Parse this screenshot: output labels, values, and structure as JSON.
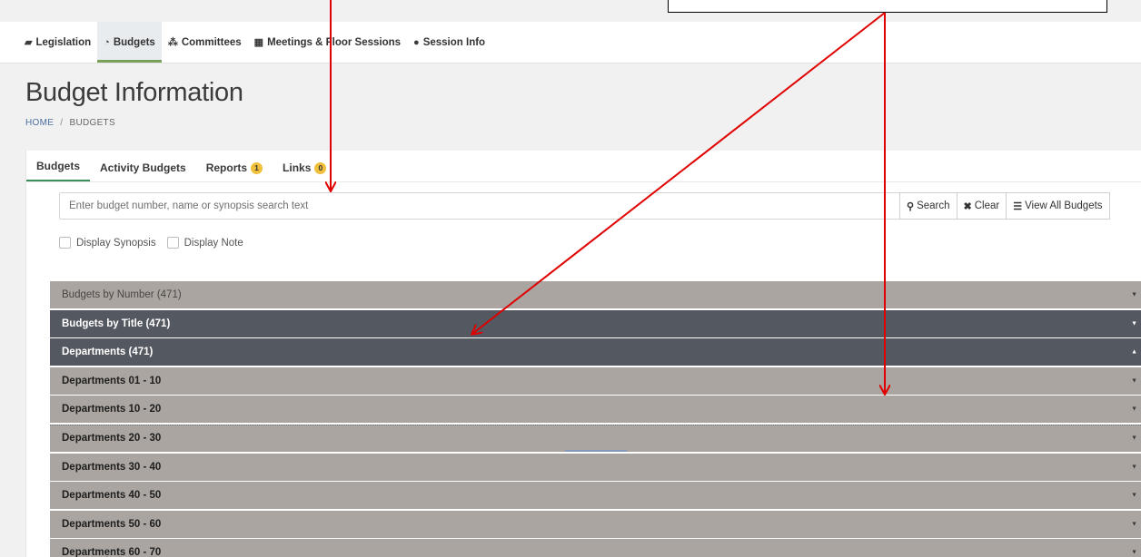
{
  "topnav": {
    "items": [
      {
        "label": "Legislation",
        "icon": "book-icon",
        "glyph": "▰"
      },
      {
        "label": "Budgets",
        "icon": "pie-chart-icon",
        "glyph": "◔",
        "active": true
      },
      {
        "label": "Committees",
        "icon": "users-icon",
        "glyph": "⁂"
      },
      {
        "label": "Meetings & Floor Sessions",
        "icon": "calendar-icon",
        "glyph": "▦"
      },
      {
        "label": "Session Info",
        "icon": "info-icon",
        "glyph": "●"
      }
    ]
  },
  "header": {
    "title": "Budget Information",
    "breadcrumb": {
      "home": "HOME",
      "separator": "/",
      "current": "BUDGETS"
    }
  },
  "tabs": [
    {
      "label": "Budgets",
      "active": true
    },
    {
      "label": "Activity Budgets"
    },
    {
      "label": "Reports",
      "badge": "1"
    },
    {
      "label": "Links",
      "badge": "0"
    }
  ],
  "search": {
    "placeholder": "Enter budget number, name or synopsis search text",
    "value": "",
    "buttons": [
      {
        "label": "Search",
        "icon": "search-icon",
        "glyph": "⚲"
      },
      {
        "label": "Clear",
        "icon": "close-icon",
        "glyph": "✖"
      },
      {
        "label": "View All Budgets",
        "icon": "list-icon",
        "glyph": "☰"
      }
    ]
  },
  "options": {
    "display_synopsis": "Display Synopsis",
    "display_note": "Display Note"
  },
  "accordion": {
    "panels": [
      {
        "label": "Budgets by Number (471)",
        "style": "light",
        "caret": "▼"
      },
      {
        "label": "Budgets by Title (471)",
        "style": "dark",
        "caret": "▼"
      },
      {
        "label": "Departments (471)",
        "style": "dark",
        "caret": "▲"
      },
      {
        "label": "Departments 01 - 10",
        "style": "sub",
        "caret": "▼"
      },
      {
        "label": "Departments 10 - 20",
        "style": "sub",
        "caret": "▼"
      },
      {
        "label": "Departments 20 - 30",
        "style": "sub",
        "caret": "▼",
        "focused": true
      },
      {
        "label": "Departments 30 - 40",
        "style": "sub",
        "caret": "▼"
      },
      {
        "label": "Departments 40 - 50",
        "style": "sub",
        "caret": "▼"
      },
      {
        "label": "Departments 50 - 60",
        "style": "sub",
        "caret": "▼"
      },
      {
        "label": "Departments 60 - 70",
        "style": "sub",
        "caret": "▼"
      }
    ]
  },
  "colors": {
    "accent_green": "#3a8f5a",
    "panel_light": "#aaa5a1",
    "panel_dark": "#545860",
    "badge_yellow": "#f0c03c",
    "annotation_arrow": "#e00000"
  }
}
